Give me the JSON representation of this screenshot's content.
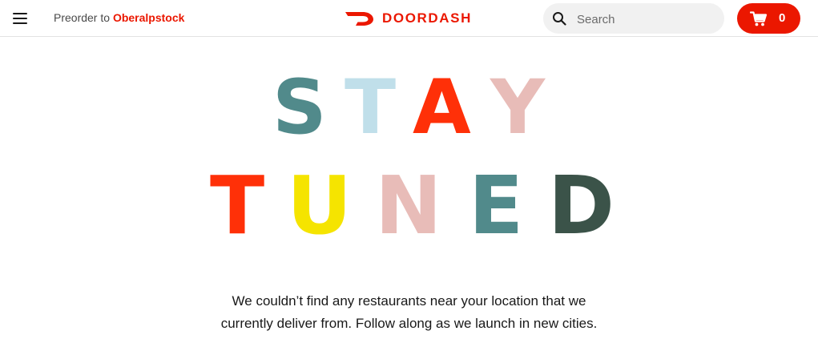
{
  "header": {
    "preorder_prefix": "Preorder to",
    "preorder_location": "Oberalpstock",
    "brand_name": "DOORDASH",
    "search": {
      "placeholder": "Search",
      "value": ""
    },
    "cart": {
      "count": "0"
    }
  },
  "headline": {
    "line1": [
      {
        "char": "S",
        "color": "#518a8b"
      },
      {
        "char": "T",
        "color": "#c0dfea"
      },
      {
        "char": "A",
        "color": "#ff3008"
      },
      {
        "char": "Y",
        "color": "#e8bcb8"
      }
    ],
    "line2": [
      {
        "char": "T",
        "color": "#ff3008"
      },
      {
        "char": "U",
        "color": "#f5e400"
      },
      {
        "char": "N",
        "color": "#e8bcb8"
      },
      {
        "char": "E",
        "color": "#518a8b"
      },
      {
        "char": "D",
        "color": "#3b5349"
      }
    ]
  },
  "message": {
    "line1": "We couldn’t find any restaurants near your location that we",
    "line2": "currently deliver from. Follow along as we launch in new cities."
  },
  "colors": {
    "brand": "#eb1700",
    "search_bg": "#f1f1f1"
  },
  "icons": {
    "menu": "hamburger-menu-icon",
    "logo": "doordash-logo-icon",
    "search": "search-icon",
    "cart": "cart-icon"
  }
}
